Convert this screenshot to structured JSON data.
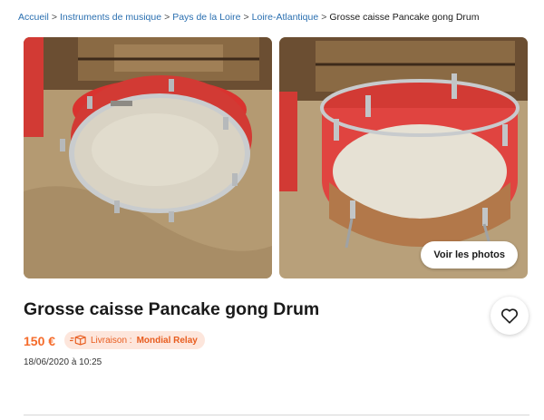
{
  "breadcrumb": {
    "items": [
      {
        "label": "Accueil"
      },
      {
        "label": "Instruments de musique"
      },
      {
        "label": "Pays de la Loire"
      },
      {
        "label": "Loire-Atlantique"
      }
    ],
    "separator": ">",
    "current": "Grosse caisse Pancake gong Drum"
  },
  "gallery": {
    "view_photos_label": "Voir les photos"
  },
  "listing": {
    "title": "Grosse caisse Pancake gong Drum",
    "price": "150 €",
    "delivery_label": "Livraison :",
    "delivery_value": "Mondial Relay",
    "date": "18/06/2020 à 10:25"
  },
  "colors": {
    "price": "#f56b2a",
    "link": "#2a6fb0",
    "badge_bg": "#fde6dc",
    "drum_red": "#e8413d"
  },
  "icons": {
    "favorite": "heart-outline-icon",
    "delivery": "package-truck-icon"
  }
}
